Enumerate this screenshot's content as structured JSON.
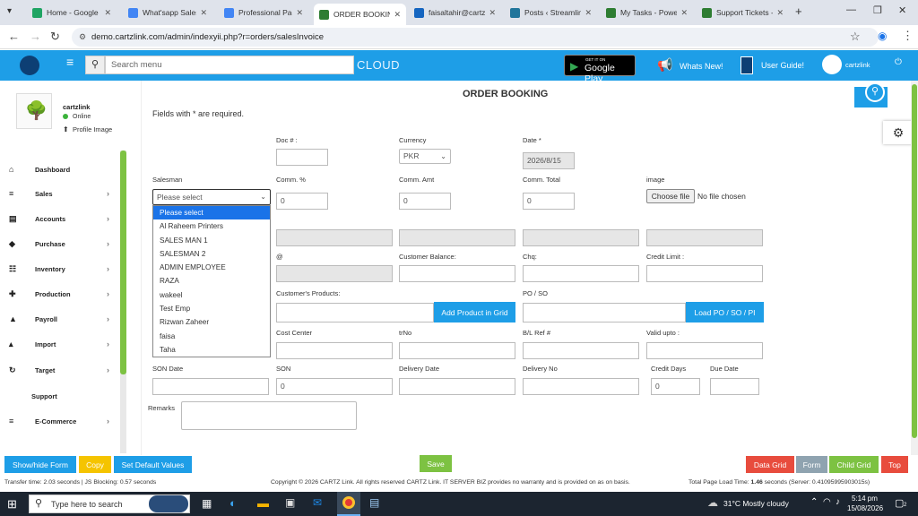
{
  "browser": {
    "tabs": [
      {
        "label": "Home - Google Drive",
        "color": "#1fa463"
      },
      {
        "label": "What'sapp Sales Manager",
        "color": "#4285f4"
      },
      {
        "label": "Professional Package",
        "color": "#4285f4"
      },
      {
        "label": "ORDER BOOKING",
        "color": "#2e7d32"
      },
      {
        "label": "faisaltahir@cartzlink",
        "color": "#1565c0"
      },
      {
        "label": "Posts ‹ Streamline",
        "color": "#21759b"
      },
      {
        "label": "My Tasks - Powered",
        "color": "#2e7d32"
      },
      {
        "label": "Support Tickets - C",
        "color": "#2e7d32"
      }
    ],
    "url": "demo.cartzlink.com/admin/indexyii.php?r=orders/salesInvoice"
  },
  "header": {
    "search_placeholder": "Search menu",
    "cloud": "CLOUD",
    "google_play_small": "GET IT ON",
    "google_play": "Google Play",
    "whats_new": "Whats New!",
    "user_guide": "User Guide!",
    "user": "cartzlink"
  },
  "sidebar": {
    "profile_name": "cartzlink",
    "status": "Online",
    "profile_image": "Profile Image",
    "items": [
      {
        "label": "Dashboard",
        "icon": "⌂",
        "chevron": ""
      },
      {
        "label": "Sales",
        "icon": "≡",
        "chevron": "›"
      },
      {
        "label": "Accounts",
        "icon": "▤",
        "chevron": "›"
      },
      {
        "label": "Purchase",
        "icon": "◆",
        "chevron": "›"
      },
      {
        "label": "Inventory",
        "icon": "☷",
        "chevron": "›"
      },
      {
        "label": "Production",
        "icon": "✚",
        "chevron": "›"
      },
      {
        "label": "Payroll",
        "icon": "▲",
        "chevron": "›"
      },
      {
        "label": "Import",
        "icon": "▴",
        "chevron": "›"
      },
      {
        "label": "Target",
        "icon": "↻",
        "chevron": "›"
      },
      {
        "label": "Support",
        "icon": "",
        "chevron": ""
      },
      {
        "label": "E-Commerce",
        "icon": "≡",
        "chevron": "›"
      }
    ]
  },
  "form": {
    "title": "ORDER BOOKING",
    "required_note": "Fields with * are required.",
    "doc_label": "Doc # :",
    "currency_label": "Currency",
    "currency_value": "PKR",
    "date_label": "Date *",
    "date_value": "2026/8/15",
    "salesman_label": "Salesman",
    "salesman_value": "Please select",
    "comm_pct_label": "Comm. %",
    "comm_pct_value": "0",
    "comm_amt_label": "Comm. Amt",
    "comm_amt_value": "0",
    "comm_total_label": "Comm. Total",
    "comm_total_value": "0",
    "image_label": "image",
    "choose_file": "Choose file",
    "no_file": "No file chosen",
    "at_label": "@",
    "cust_balance_label": "Customer Balance:",
    "chq_label": "Chq:",
    "credit_limit_label": "Credit Limit :",
    "cust_products_label": "Customer's Products:",
    "add_product_btn": "Add Product in Grid",
    "po_so_label": "PO / SO",
    "load_po_btn": "Load PO / SO / PI",
    "cost_center_label": "Cost Center",
    "trno_label": "trNo",
    "bl_ref_label": "B/L Ref #",
    "valid_upto_label": "Valid upto :",
    "son_date_label": "SON Date",
    "son_label": "SON",
    "son_value": "0",
    "delivery_date_label": "Delivery Date",
    "delivery_no_label": "Delivery No",
    "credit_days_label": "Credit Days",
    "credit_days_value": "0",
    "due_date_label": "Due Date",
    "remarks_label": "Remarks",
    "top_btn": "C"
  },
  "salesman_options": [
    "Please select",
    "Al Raheem Printers",
    "SALES MAN 1",
    "SALESMAN 2",
    "ADMIN EMPLOYEE",
    "RAZA",
    "wakeel",
    "Test Emp",
    "Rizwan Zaheer",
    "faisa",
    "Taha"
  ],
  "bottom": {
    "show_hide": "Show/hide Form",
    "copy": "Copy",
    "set_default": "Set Default Values",
    "save": "Save",
    "data_grid": "Data Grid",
    "form": "Form",
    "child_grid": "Child Grid",
    "top": "Top"
  },
  "footer": {
    "transfer": "Transfer time: 2.03 seconds | JS Blocking: 0.57 seconds",
    "copyright": "Copyright © 2026 CARTZ Link. All rights reserved CARTZ Link. IT SERVER BIZ provides no warranty and is provided on as on basis.",
    "load_prefix": "Total Page Load Time:",
    "load_time": "1.46",
    "load_suffix": "seconds (Server: 0.41095995903015s)"
  },
  "taskbar": {
    "search": "Type here to search",
    "weather": "31°C  Mostly cloudy",
    "time": "5:14 pm",
    "date": "15/08/2026",
    "notif": "2"
  }
}
